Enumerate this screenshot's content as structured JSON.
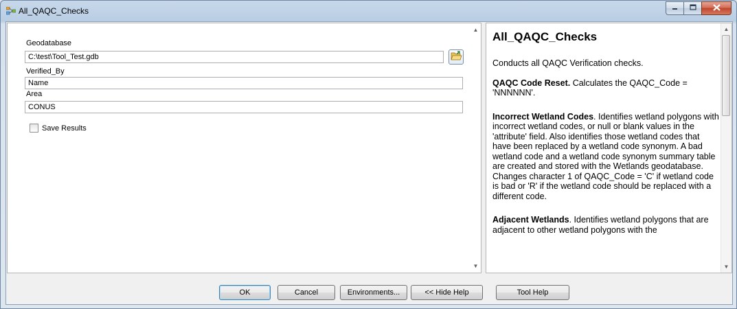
{
  "window": {
    "title": "All_QAQC_Checks",
    "controls": [
      "minimize-icon",
      "maximize-icon",
      "close-icon"
    ]
  },
  "form": {
    "geodatabase_label": "Geodatabase",
    "geodatabase_value": "C:\\test\\Tool_Test.gdb",
    "verified_by_label": "Verified_By",
    "verified_by_value": "Name",
    "area_label": "Area",
    "area_value": "CONUS",
    "save_results_label": "Save Results",
    "save_results_checked": false
  },
  "help": {
    "title": "All_QAQC_Checks",
    "intro": "Conducts all QAQC Verification checks.",
    "sections": [
      {
        "heading": "QAQC Code Reset.",
        "text": " Calculates the QAQC_Code = 'NNNNNN'."
      },
      {
        "heading": "Incorrect Wetland Codes",
        "text": ". Identifies wetland polygons with incorrect wetland codes, or null or blank values in the 'attribute' field. Also identifies those wetland codes that have been replaced by a wetland code synonym. A bad wetland code and a wetland code synonym summary table are created and stored with the Wetlands geodatabase. Changes character 1 of QAQC_Code = 'C' if wetland code is bad or 'R' if the wetland code should be replaced with a different code."
      },
      {
        "heading": "Adjacent Wetlands",
        "text": ". Identifies wetland polygons that are adjacent to other wetland polygons with the"
      }
    ]
  },
  "buttons": {
    "ok": "OK",
    "cancel": "Cancel",
    "environments": "Environments...",
    "hide_help": "<< Hide Help",
    "tool_help": "Tool Help"
  }
}
